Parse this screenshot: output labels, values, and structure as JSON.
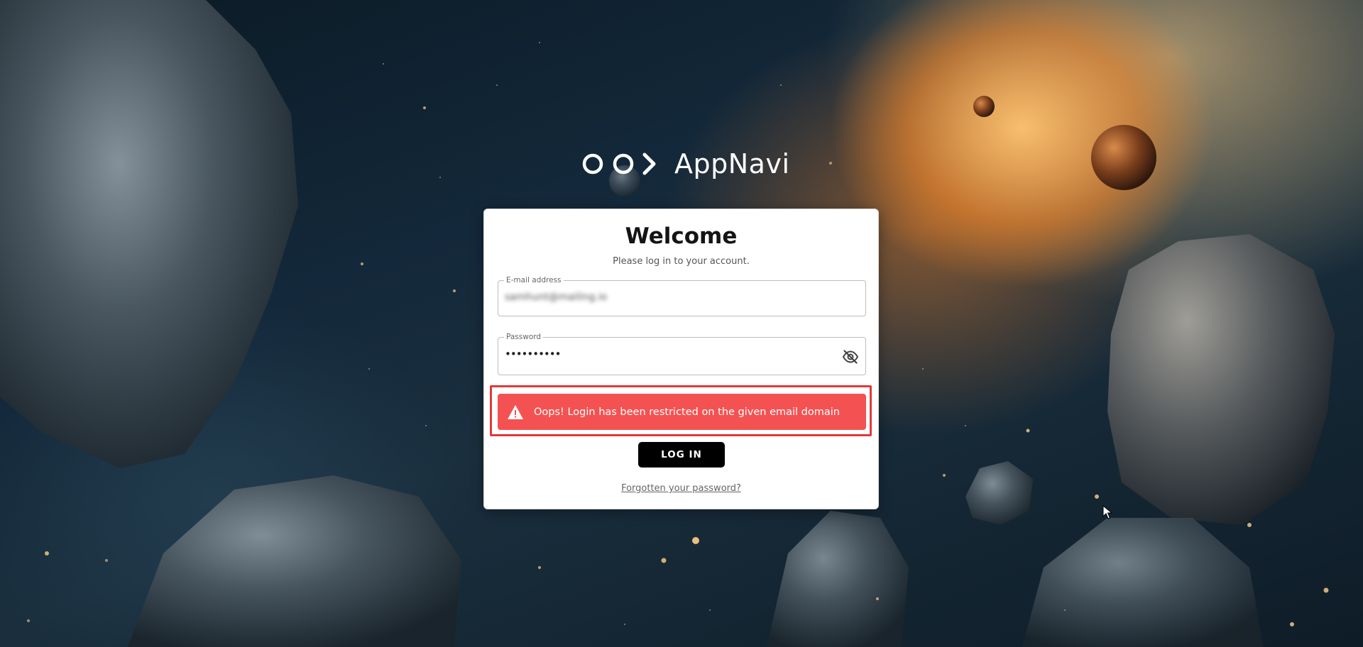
{
  "app": {
    "name": "AppNavi"
  },
  "login": {
    "title": "Welcome",
    "subtitle": "Please log in to your account.",
    "email_label": "E-mail address",
    "email_value": "samhunt@mailing.io",
    "password_label": "Password",
    "password_value": "••••••••••",
    "error_message": "Oops! Login has been restricted on the given email domain",
    "login_button": "LOG IN",
    "forgot_link": "Forgotten your password?"
  },
  "colors": {
    "error_bg": "#f45252",
    "error_outline": "#e03a3a",
    "button_bg": "#000000"
  },
  "icons": {
    "logo": "appnavi-logo-icon",
    "eye": "eye-off-icon",
    "warning": "warning-icon",
    "cursor": "mouse-cursor-icon"
  }
}
